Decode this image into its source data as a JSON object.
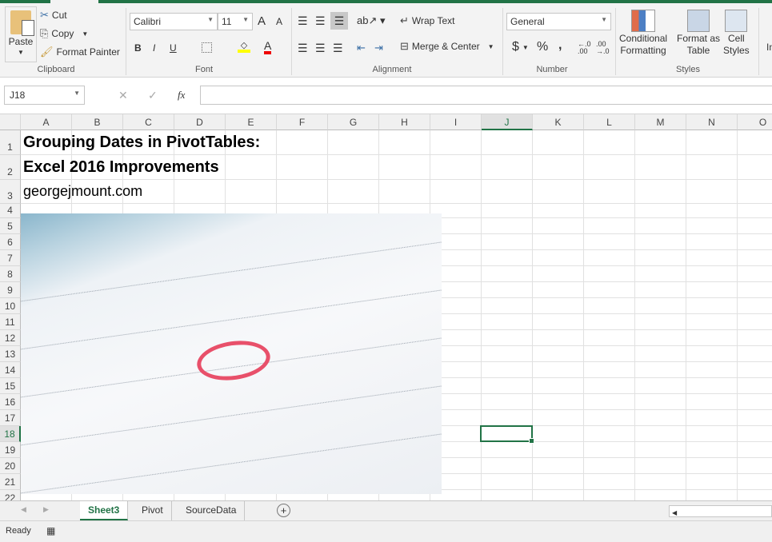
{
  "ribbon": {
    "clipboard": {
      "paste": "Paste",
      "cut": "Cut",
      "copy": "Copy",
      "format_painter": "Format Painter",
      "label": "Clipboard"
    },
    "font": {
      "name": "Calibri",
      "size": "11",
      "label": "Font",
      "bold": "B",
      "italic": "I",
      "underline": "U",
      "grow": "A",
      "shrink": "A",
      "font_color": "A"
    },
    "alignment": {
      "wrap": "Wrap Text",
      "merge": "Merge & Center",
      "label": "Alignment"
    },
    "number": {
      "format": "General",
      "currency": "$",
      "percent": "%",
      "comma": ",",
      "inc_dec": "←.0 .00",
      "dec_dec": ".00 →.0",
      "label": "Number"
    },
    "styles": {
      "conditional": "Conditional",
      "conditional2": "Formatting",
      "format_as": "Format as",
      "format_as2": "Table",
      "cell": "Cell",
      "cell2": "Styles",
      "label": "Styles"
    },
    "insert_partial": "In"
  },
  "formula_bar": {
    "name_box": "J18",
    "fx": "fx",
    "cancel": "✕",
    "enter": "✓",
    "value": ""
  },
  "columns": [
    "A",
    "B",
    "C",
    "D",
    "E",
    "F",
    "G",
    "H",
    "I",
    "J",
    "K",
    "L",
    "M",
    "N",
    "O"
  ],
  "selected_column": "J",
  "rows": [
    "1",
    "2",
    "3",
    "4",
    "5",
    "6",
    "7",
    "8",
    "9",
    "10",
    "11",
    "12",
    "13",
    "14",
    "15",
    "16",
    "17",
    "18",
    "19",
    "20",
    "21",
    "22"
  ],
  "selected_row": "18",
  "cells": {
    "A1": "Grouping Dates in PivotTables:",
    "A2": "Excel 2016 Improvements",
    "A3": "georgejmount.com"
  },
  "sheets": [
    "Sheet3",
    "Pivot",
    "SourceData"
  ],
  "active_sheet": "Sheet3",
  "status": {
    "ready": "Ready"
  },
  "colors": {
    "accent": "#217346"
  }
}
